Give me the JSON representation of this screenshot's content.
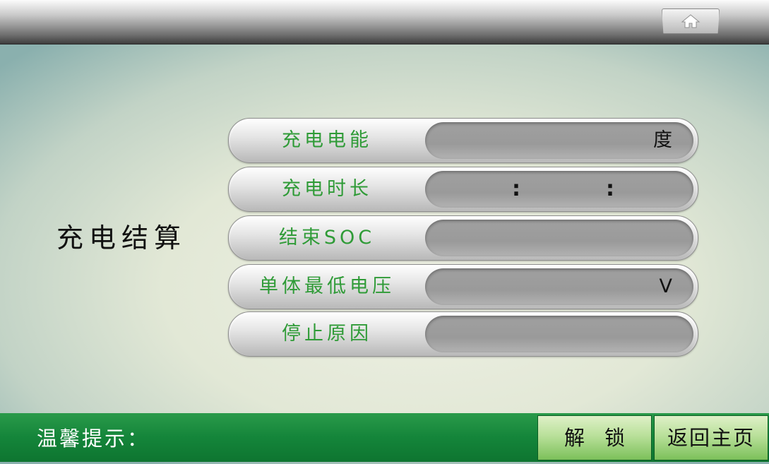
{
  "page": {
    "title": "充电结算"
  },
  "fields": [
    {
      "label": "充电电能",
      "value": "",
      "unit": "度"
    },
    {
      "label": "充电时长",
      "value": "",
      "separator": ":"
    },
    {
      "label": "结束SOC",
      "value": ""
    },
    {
      "label": "单体最低电压",
      "value": "",
      "unit": "V"
    },
    {
      "label": "停止原因",
      "value": ""
    }
  ],
  "footer": {
    "tip_label": "温馨提示：",
    "unlock_label": "解锁",
    "home_label": "返回主页"
  },
  "icons": {
    "top_home": "home-icon"
  },
  "colors": {
    "accent_green": "#2f9b37",
    "bar_green": "#14853a"
  }
}
